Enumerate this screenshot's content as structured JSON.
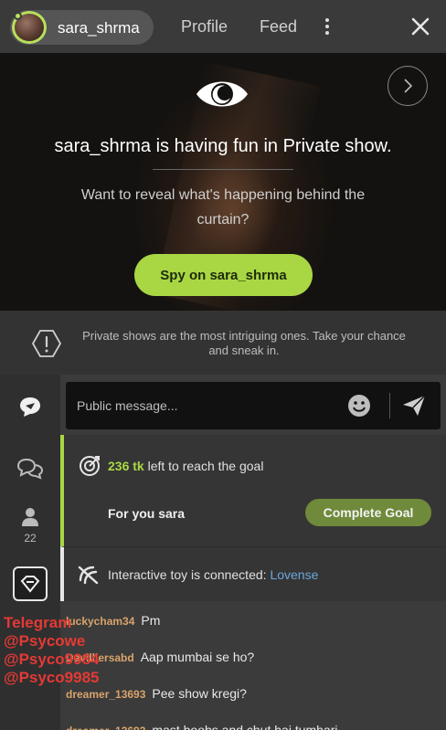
{
  "header": {
    "username": "sara_shrma",
    "nav": [
      {
        "label": "Profile"
      },
      {
        "label": "Feed"
      }
    ],
    "colors": {
      "accent": "#a9d744",
      "bar": "#3a3a3a"
    }
  },
  "hero": {
    "title": "sara_shrma is having fun in Private show.",
    "subtitle": "Want to reveal what's happening behind the curtain?",
    "cta_label": "Spy on sara_shrma",
    "icons": [
      "eye-icon",
      "chevron-right-icon"
    ]
  },
  "notice": {
    "text": "Private shows are the most intriguing ones. Take your chance and sneak in.",
    "icon": "warning-icon"
  },
  "sidebar": {
    "items": [
      "chat-bubble-icon",
      "chats-icon",
      "users-icon",
      "toy-icon"
    ],
    "viewer_count": "22"
  },
  "composer": {
    "placeholder": "Public message..."
  },
  "goal": {
    "amount": "236 tk",
    "text": "left to reach the goal",
    "for_label": "For you sara",
    "button_label": "Complete Goal"
  },
  "toy": {
    "text": "Interactive toy is connected:",
    "brand": "Lovense"
  },
  "messages": [
    {
      "user": "luckycham34",
      "text": "Pm"
    },
    {
      "user": "Devilliersabd",
      "text": "Aap mumbai se ho?"
    },
    {
      "user": "dreamer_13693",
      "text": "Pee show kregi?"
    },
    {
      "user": "dreamer_13693",
      "text": "mast boobs and chut hai tumhari"
    }
  ],
  "watermark": {
    "lines": [
      "Telegram",
      "@Psycowe",
      "@Psyco9984",
      "@Psyco9985"
    ]
  }
}
